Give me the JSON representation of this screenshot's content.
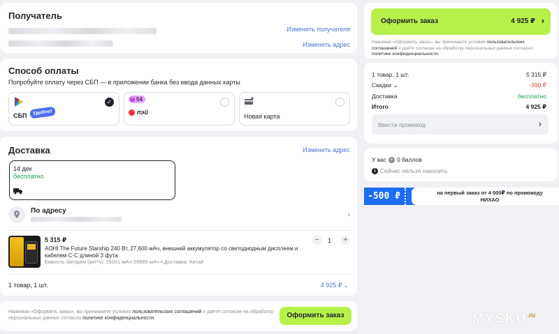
{
  "recipient": {
    "title": "Получатель",
    "change_recipient": "Изменить получателя",
    "change_address": "Изменить адрес"
  },
  "payment": {
    "title": "Способ оплаты",
    "hint": "Попробуйте оплату через СБП — в приложении банка без ввода данных карты",
    "sbp_label": "СБП",
    "sbp_badge": "Удобно!",
    "pei_count": "54",
    "pei_label": "пэй",
    "new_card_label": "Новая карта"
  },
  "delivery": {
    "title": "Доставка",
    "change_address": "Изменить адрес",
    "date": "14 дек",
    "price": "бесплатно",
    "address_label": "По адресу"
  },
  "product": {
    "price": "5 315 ₽",
    "name": "AOHI The Future Starship 240 Вт, 27,600 мАч, внешний аккумулятор со светодиодным дисплеем и кабелем C-C длиной 3 фута",
    "specs": "Емкость батареи (мА*ч): 25001 мАч-29999 мАч • Доставка: Китай",
    "qty": "1",
    "minus": "−",
    "plus": "+"
  },
  "delivery_summary": {
    "items": "1 товар, 1 шт.",
    "total": "4 925 ₽"
  },
  "footer": {
    "legal_pre": "Нажимая «Оформить заказ», вы принимаете условия ",
    "legal_link1": "пользовательских соглашений",
    "legal_mid": " и даёте согласие на обработку персональных данных согласно ",
    "legal_link2": "политике конфиденциальности",
    "legal_end": ".",
    "button": "Оформить заказ"
  },
  "order": {
    "button_label": "Оформить заказ",
    "button_price": "4 925 ₽",
    "legal_pre": "Нажимая «Оформить заказ», вы принимаете условия ",
    "legal_link1": "пользовательских соглашений",
    "legal_mid": " и даёте согласие на обработку персональных данных согласно ",
    "legal_link2": "политике конфиденциальности",
    "legal_end": "."
  },
  "summary": {
    "items_label": "1 товар, 1 шт.",
    "items_value": "5 315 ₽",
    "discount_label": "Скидки",
    "discount_value": "-390 ₽",
    "shipping_label": "Доставка",
    "shipping_value": "бесплатно",
    "total_label": "Итого",
    "total_value": "4 925 ₽",
    "promo_placeholder": "Ввести промокод"
  },
  "points": {
    "balance_pre": "У вас",
    "balance_value": "0 баллов",
    "info": "Сейчас нельзя накопить"
  },
  "promo_banner": {
    "amount": "-500 ₽",
    "text_line1": "на первый заказ от 4 000₽ по промокоду",
    "text_line2": "НИХАО"
  },
  "watermark": "MYSKU",
  "watermark_suffix": ".ru",
  "colors": {
    "accent_green": "#b8f04a",
    "link_blue": "#4a74d6",
    "free_green": "#1aa34a",
    "discount_red": "#e5483a",
    "banner_blue": "#1c6ef2"
  }
}
